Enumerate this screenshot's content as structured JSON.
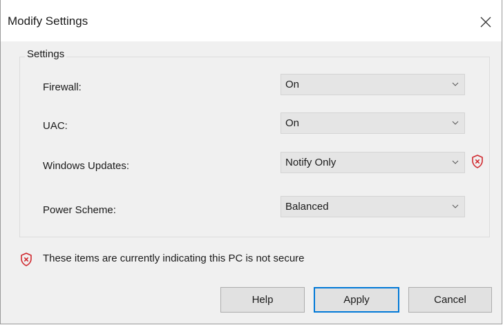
{
  "window": {
    "title": "Modify Settings"
  },
  "group": {
    "title": "Settings"
  },
  "fields": {
    "firewall": {
      "label": "Firewall:",
      "value": "On"
    },
    "uac": {
      "label": "UAC:",
      "value": "On"
    },
    "windows_updates": {
      "label": "Windows Updates:",
      "value": "Notify Only",
      "warning_icon": "shield-x-icon"
    },
    "power_scheme": {
      "label": "Power Scheme:",
      "value": "Balanced"
    }
  },
  "warning": {
    "text": "These items are currently indicating this PC is not secure",
    "icon": "shield-x-icon"
  },
  "buttons": {
    "help": "Help",
    "apply": "Apply",
    "cancel": "Cancel"
  },
  "colors": {
    "warning_red": "#d0282e",
    "focus_blue": "#0078d7"
  }
}
